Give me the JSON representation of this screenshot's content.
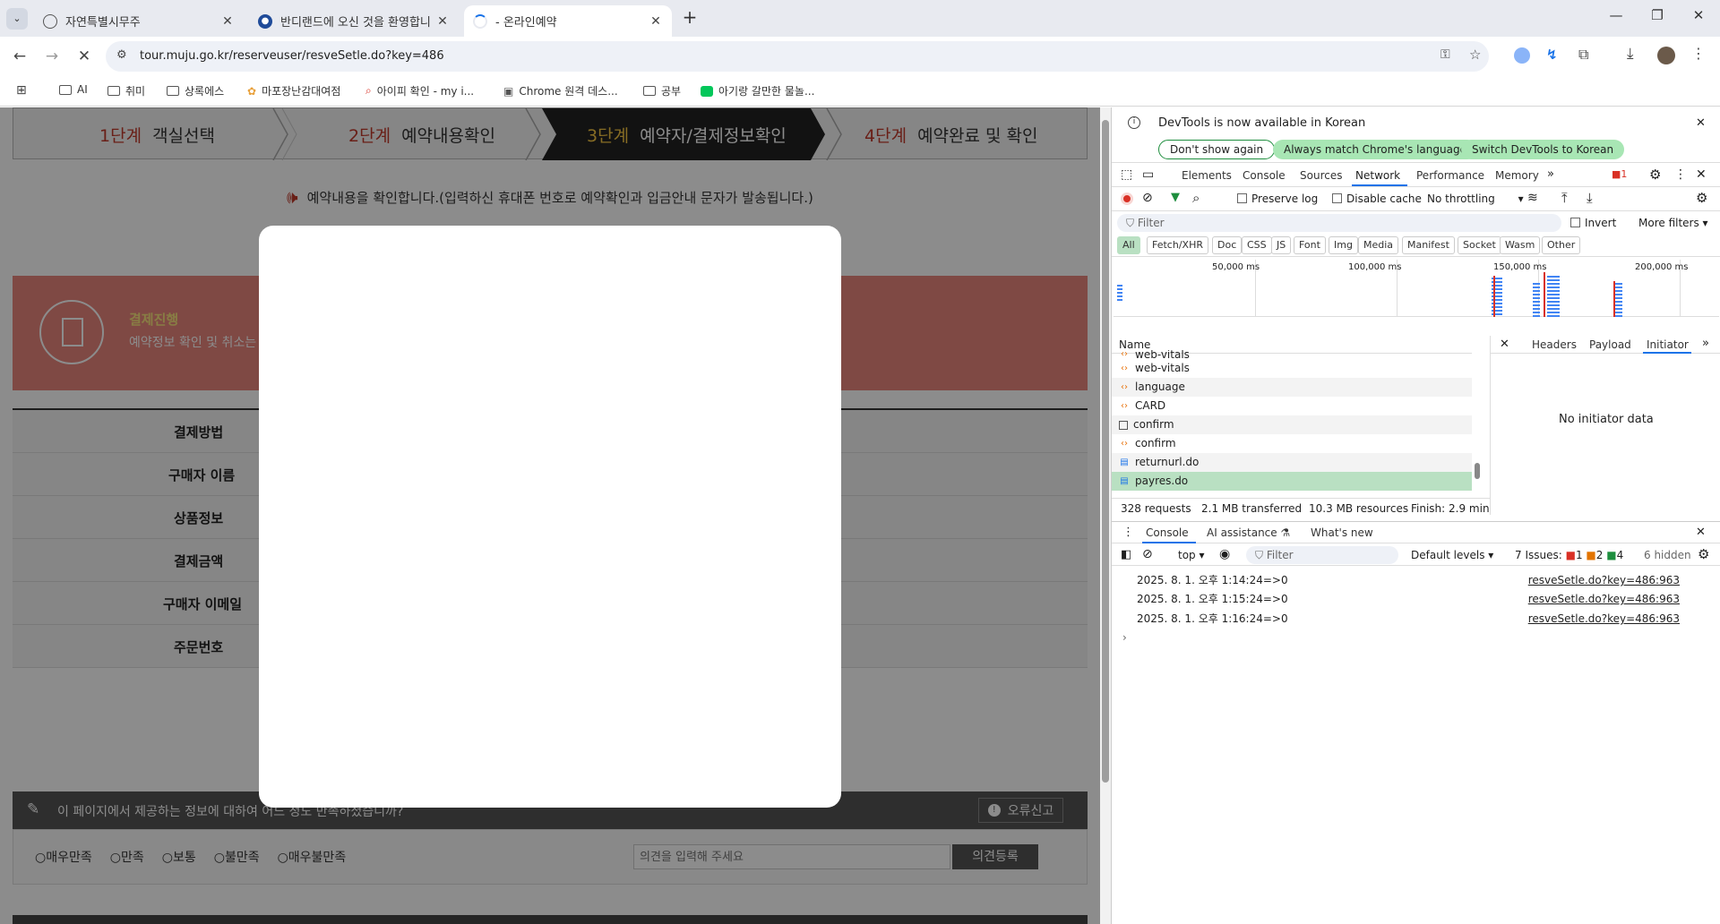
{
  "tabs": [
    {
      "title": "자연특별시무주",
      "icon": "globe"
    },
    {
      "title": "반디랜드에 오신 것을 환영합니",
      "icon": "shield"
    },
    {
      "title": " - 온라인예약",
      "icon": "loading"
    }
  ],
  "toolbar": {
    "url": "tour.muju.go.kr/reserveuser/resveSetle.do?key=486"
  },
  "bookmarks": [
    "AI",
    "취미",
    "상록에스",
    "마포장난감대여점",
    "아이피 확인 - my i...",
    "Chrome 원격 데스...",
    "공부",
    "아기랑 갈만한 물놀..."
  ],
  "page": {
    "steps": [
      {
        "num": "1단계",
        "label": "객실선택"
      },
      {
        "num": "2단계",
        "label": "예약내용확인"
      },
      {
        "num": "3단계",
        "label": "예약자/결제정보확인"
      },
      {
        "num": "4단계",
        "label": "예약완료 및 확인"
      }
    ],
    "notice": "예약내용을 확인합니다.(입력하신 휴대폰 번호로 예약확인과 입금안내 문자가 발송됩니다.)",
    "banner": {
      "title": "결제진행",
      "desc": "예약정보 확인 및 취소는 '"
    },
    "rows": [
      "결제방법",
      "구매자 이름",
      "상품정보",
      "결제금액",
      "구매자 이메일",
      "주문번호"
    ],
    "survey": {
      "question": "이 페이지에서 제공하는 정보에 대하여 어느 정도 만족하셨습니까?",
      "report": "오류신고",
      "options": [
        "매우만족",
        "만족",
        "보통",
        "불만족",
        "매우불만족"
      ],
      "placeholder": "의견을 입력해 주세요",
      "submit": "의견등록"
    }
  },
  "devtools": {
    "infobar": {
      "message": "DevTools is now available in Korean",
      "btn1": "Don't show again",
      "btn2": "Always match Chrome's language",
      "btn3": "Switch DevTools to Korean"
    },
    "tabs": [
      "Elements",
      "Console",
      "Sources",
      "Network",
      "Performance",
      "Memory"
    ],
    "active_tab": "Network",
    "error_count": "1",
    "network_toolbar": {
      "preserve_log": "Preserve log",
      "disable_cache": "Disable cache",
      "throttle": "No throttling"
    },
    "filter": {
      "placeholder": "Filter",
      "invert": "Invert",
      "more": "More filters"
    },
    "type_filters": [
      "All",
      "Fetch/XHR",
      "Doc",
      "CSS",
      "JS",
      "Font",
      "Img",
      "Media",
      "Manifest",
      "Socket",
      "Wasm",
      "Other"
    ],
    "timeline_ticks": [
      "50,000 ms",
      "100,000 ms",
      "150,000 ms",
      "200,000 ms"
    ],
    "name_header": "Name",
    "requests": [
      {
        "name": "web-vitals",
        "type": "script"
      },
      {
        "name": "web-vitals",
        "type": "script"
      },
      {
        "name": "language",
        "type": "script"
      },
      {
        "name": "CARD",
        "type": "script"
      },
      {
        "name": "confirm",
        "type": "other"
      },
      {
        "name": "confirm",
        "type": "script"
      },
      {
        "name": "returnurl.do",
        "type": "doc"
      },
      {
        "name": "payres.do",
        "type": "doc"
      }
    ],
    "detail_tabs": [
      "Headers",
      "Payload",
      "Initiator"
    ],
    "detail_active": "Initiator",
    "no_initiator": "No initiator data",
    "summary": {
      "requests": "328 requests",
      "transferred": "2.1 MB transferred",
      "resources": "10.3 MB resources",
      "finish": "Finish: 2.9 min"
    },
    "drawer_tabs": [
      "Console",
      "AI assistance",
      "What's new"
    ],
    "console_toolbar": {
      "context": "top",
      "filter": "Filter",
      "levels": "Default levels",
      "issues_label": "7 Issues:",
      "issues_error": "1",
      "issues_warn": "2",
      "issues_info": "4",
      "hidden": "6 hidden"
    },
    "console_logs": [
      {
        "text": "2025. 8. 1. 오후 1:14:24=>0",
        "source": "resveSetle.do?key=486:963"
      },
      {
        "text": "2025. 8. 1. 오후 1:15:24=>0",
        "source": "resveSetle.do?key=486:963"
      },
      {
        "text": "2025. 8. 1. 오후 1:16:24=>0",
        "source": "resveSetle.do?key=486:963"
      }
    ]
  }
}
